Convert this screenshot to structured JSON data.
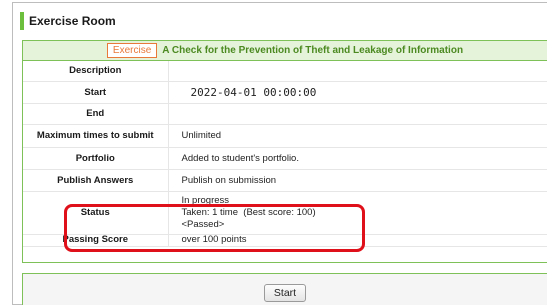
{
  "page": {
    "title": "Exercise Room"
  },
  "exercise": {
    "badge": "Exercise",
    "title": "A Check for the Prevention of Theft and Leakage of Information"
  },
  "details": {
    "description": {
      "label": "Description",
      "value": ""
    },
    "start": {
      "label": "Start",
      "value": "2022-04-01 00:00:00"
    },
    "end": {
      "label": "End",
      "value": ""
    },
    "max_submit": {
      "label": "Maximum times to submit",
      "value": "Unlimited"
    },
    "portfolio": {
      "label": "Portfolio",
      "value": "Added to student's portfolio."
    },
    "publish_answers": {
      "label": "Publish Answers",
      "value": "Publish on submission"
    },
    "status": {
      "label": "Status",
      "line1": "In progress",
      "line2": "Taken: 1 time  (Best score: 100)",
      "line3": "<Passed>"
    },
    "passing_score": {
      "label": "Passing Score",
      "value": "over 100 points"
    }
  },
  "footer": {
    "start_label": "Start"
  },
  "colors": {
    "accent_green": "#6cbf3c",
    "badge_orange": "#e8793a",
    "highlight_red": "#e0101a"
  }
}
